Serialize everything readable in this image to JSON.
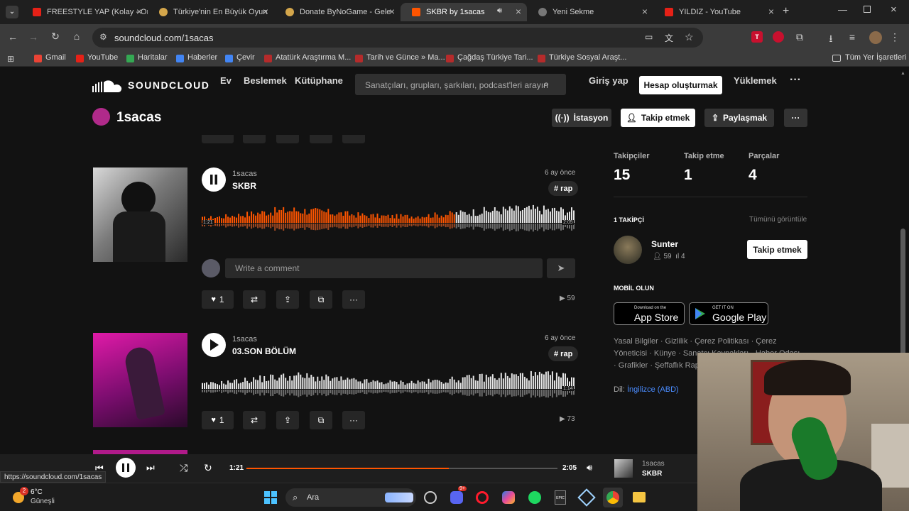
{
  "browser": {
    "tabs": [
      {
        "title": "FREESTYLE YAP (Kolay - Or",
        "color": "#e62117"
      },
      {
        "title": "Türkiye'nin En Büyük Oyun",
        "color": "#d4a64b"
      },
      {
        "title": "Donate ByNoGame - Gele",
        "color": "#d4a64b"
      },
      {
        "title": "SKBR by 1sacas",
        "color": "#ff5500"
      },
      {
        "title": "Yeni Sekme",
        "color": "#888888"
      },
      {
        "title": "YILDIZ - YouTube",
        "color": "#e62117"
      }
    ],
    "url": "soundcloud.com/1sacas",
    "bookmarks": [
      {
        "label": "Gmail",
        "color": "#ea4335"
      },
      {
        "label": "YouTube",
        "color": "#e62117"
      },
      {
        "label": "Haritalar",
        "color": "#34a853"
      },
      {
        "label": "Haberler",
        "color": "#4285f4"
      },
      {
        "label": "Çevir",
        "color": "#4285f4"
      },
      {
        "label": "Atatürk Araştırma M...",
        "color": "#b52b2b"
      },
      {
        "label": "Tarih ve Günce » Ma...",
        "color": "#b52b2b"
      },
      {
        "label": "Çağdaş Türkiye Tari...",
        "color": "#b52b2b"
      },
      {
        "label": "Türkiye Sosyal Araşt...",
        "color": "#b52b2b"
      }
    ],
    "all_bookmarks": "Tüm Yer İşaretleri",
    "status_url": "https://soundcloud.com/1sacas"
  },
  "soundcloud": {
    "logo": "SOUNDCLOUD",
    "nav": [
      "Ev",
      "Beslemek",
      "Kütüphane"
    ],
    "search_placeholder": "Sanatçıları, grupları, şarkıları, podcast'leri arayın",
    "signin": "Giriş yap",
    "create_account": "Hesap oluşturmak",
    "upload": "Yüklemek",
    "more": "···"
  },
  "profile": {
    "name": "1sacas",
    "station": "İstasyon",
    "follow": "Takip etmek",
    "share": "Paylaşmak",
    "more": "···"
  },
  "tracks": [
    {
      "user": "1sacas",
      "title": "SKBR",
      "age": "6 ay önce",
      "tag": "# rap",
      "elapsed": "1:21",
      "duration": "2:05",
      "played_fraction": 0.68,
      "likes": "1",
      "plays": "59",
      "comment_placeholder": "Write a comment",
      "playing": true
    },
    {
      "user": "1sacas",
      "title": "03.SON BÖLÜM",
      "age": "6 ay önce",
      "tag": "# rap",
      "duration": "1:14",
      "likes": "1",
      "plays": "73",
      "playing": false
    }
  ],
  "sidebar": {
    "stats": [
      {
        "label": "Takipçiler",
        "value": "15"
      },
      {
        "label": "Takip etme",
        "value": "1"
      },
      {
        "label": "Parçalar",
        "value": "4"
      }
    ],
    "followers_heading": "1 TAKİPÇİ",
    "view_all": "Tümünü görüntüle",
    "follower": {
      "name": "Sunter",
      "followers": "59",
      "tracks": "4",
      "follow": "Takip etmek"
    },
    "mobile_heading": "MOBİL OLUN",
    "app_store": {
      "small": "Download on the",
      "big": "App Store"
    },
    "google_play": {
      "small": "GET IT ON",
      "big": "Google Play"
    },
    "footer_line1": "Yasal Bilgiler · Gizlilik · Çerez Politikası · Çerez",
    "footer_line2": "Yöneticisi · Künye · Sanatçı Kaynakları · Haber Odası",
    "footer_line3": "· Grafikler · Şeffaflık Raporu",
    "language_label": "Dil:",
    "language_value": "İngilizce (ABD)"
  },
  "player": {
    "elapsed": "1:21",
    "duration": "2:05",
    "progress_fraction": 0.65,
    "user": "1sacas",
    "title": "SKBR"
  },
  "taskbar": {
    "temp": "6°C",
    "weather": "Güneşli",
    "search": "Ara",
    "notif_count": "2",
    "discord_badge": "9+"
  },
  "colors": {
    "accent": "#ff5500",
    "bg": "#121212"
  }
}
